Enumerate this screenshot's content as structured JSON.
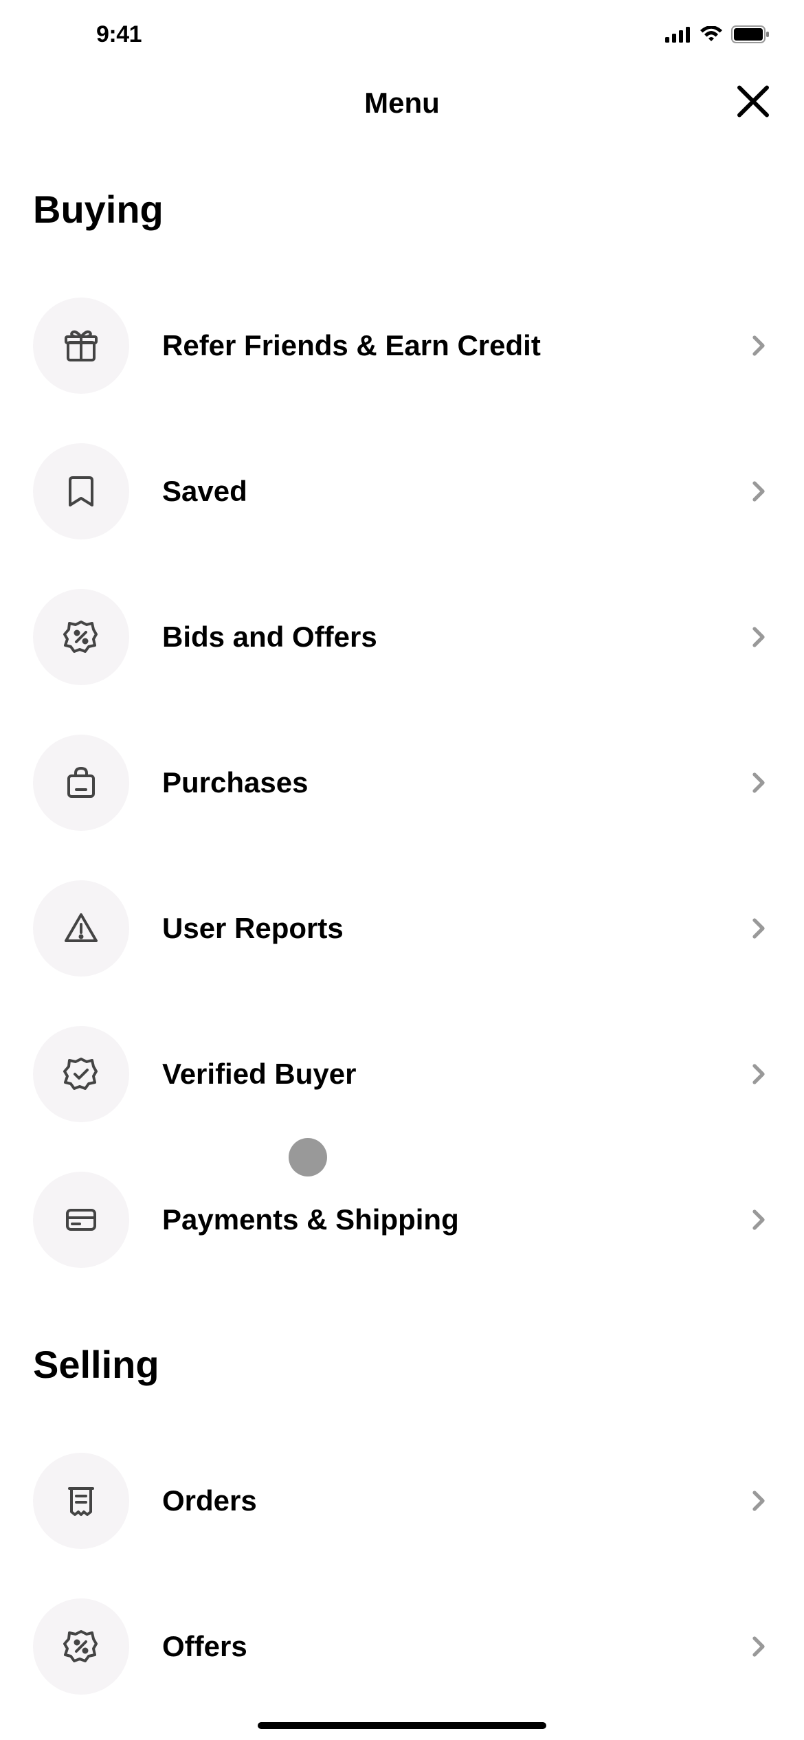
{
  "statusBar": {
    "time": "9:41"
  },
  "header": {
    "title": "Menu"
  },
  "sections": [
    {
      "title": "Buying",
      "items": [
        {
          "label": "Refer Friends & Earn Credit",
          "icon": "gift"
        },
        {
          "label": "Saved",
          "icon": "bookmark"
        },
        {
          "label": "Bids and Offers",
          "icon": "percent-badge"
        },
        {
          "label": "Purchases",
          "icon": "bag"
        },
        {
          "label": "User Reports",
          "icon": "warning"
        },
        {
          "label": "Verified Buyer",
          "icon": "check-badge"
        },
        {
          "label": "Payments & Shipping",
          "icon": "card"
        }
      ]
    },
    {
      "title": "Selling",
      "items": [
        {
          "label": "Orders",
          "icon": "receipt"
        },
        {
          "label": "Offers",
          "icon": "percent-badge"
        }
      ]
    }
  ]
}
